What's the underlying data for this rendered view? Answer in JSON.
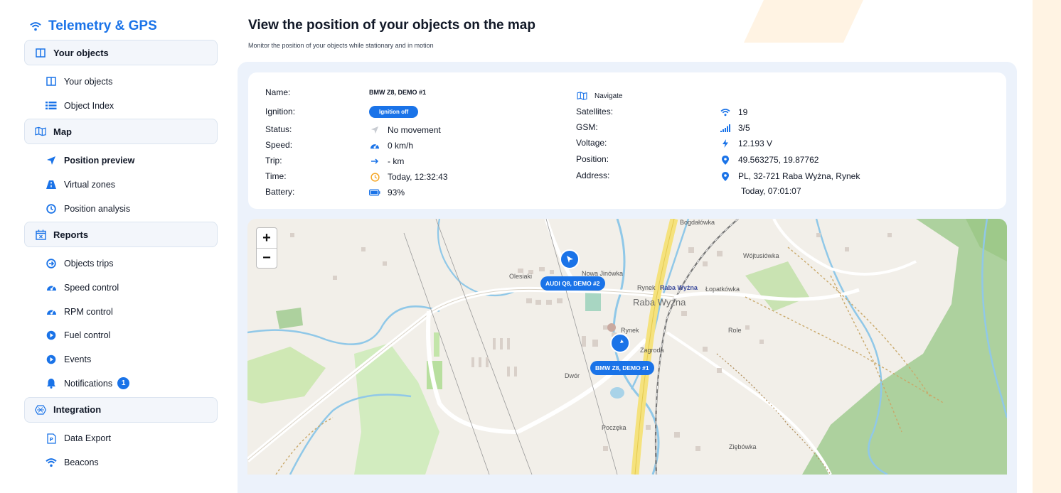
{
  "brand": {
    "title": "Telemetry & GPS"
  },
  "sidebar": {
    "sections": [
      {
        "label": "Your objects",
        "items": [
          {
            "label": "Your objects"
          },
          {
            "label": "Object Index"
          }
        ]
      },
      {
        "label": "Map",
        "items": [
          {
            "label": "Position preview"
          },
          {
            "label": "Virtual zones"
          },
          {
            "label": "Position analysis"
          }
        ]
      },
      {
        "label": "Reports",
        "items": [
          {
            "label": "Objects trips"
          },
          {
            "label": "Speed control"
          },
          {
            "label": "RPM control"
          },
          {
            "label": "Fuel control"
          },
          {
            "label": "Events"
          },
          {
            "label": "Notifications",
            "badge": "1"
          }
        ]
      },
      {
        "label": "Integration",
        "items": [
          {
            "label": "Data Export"
          },
          {
            "label": "Beacons"
          }
        ]
      }
    ]
  },
  "page": {
    "title": "View the position of your objects on the map",
    "subtitle": "Monitor the position of your objects while stationary and in motion"
  },
  "details": {
    "name_label": "Name:",
    "name": "BMW Z8, DEMO #1",
    "ignition_label": "Ignition:",
    "ignition": "Ignition off",
    "status_label": "Status:",
    "status": "No movement",
    "speed_label": "Speed:",
    "speed": "0 km/h",
    "trip_label": "Trip:",
    "trip": "- km",
    "time_label": "Time:",
    "time": "Today, 12:32:43",
    "battery_label": "Battery:",
    "battery": "93%",
    "navigate": "Navigate",
    "satellites_label": "Satellites:",
    "satellites": "19",
    "gsm_label": "GSM:",
    "gsm": "3/5",
    "voltage_label": "Voltage:",
    "voltage": "12.193 V",
    "position_label": "Position:",
    "position": "49.563275, 19.87762",
    "address_label": "Address:",
    "address": "PL, 32-721 Raba Wyżna, Rynek",
    "address_time": "Today, 07:01:07"
  },
  "map": {
    "zoom_in": "+",
    "zoom_out": "−",
    "markers": [
      {
        "label": "AUDI Q8, DEMO #2"
      },
      {
        "label": "BMW Z8, DEMO #1"
      }
    ],
    "places": [
      "Bogdałówka",
      "Wójtusiówka",
      "Olesiaki",
      "Nowa Jinówka",
      "Rynek",
      "Raba Wyżna",
      "Łopatkówka",
      "Raba Wyżna",
      "Rynek",
      "Zagroda",
      "Role",
      "Dwór",
      "Poczęka",
      "Ziębówka"
    ]
  },
  "colors": {
    "accent": "#1a73e8",
    "panel": "#ecf2fb"
  }
}
